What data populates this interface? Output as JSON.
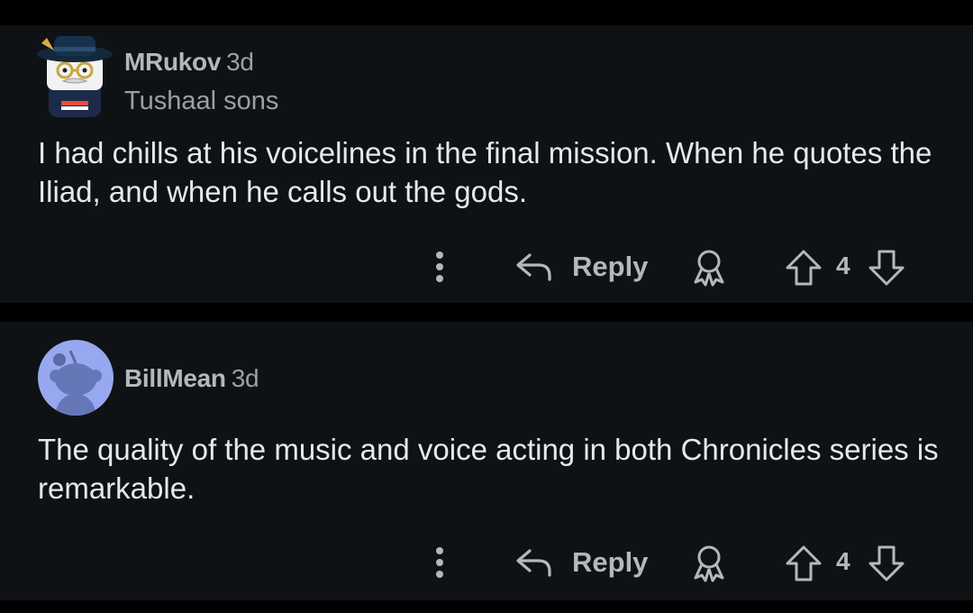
{
  "colors": {
    "background": "#000000",
    "card": "#0f1215",
    "icon": "#b4b8bc",
    "text": "#e6e8ea",
    "avatar_blue": "#97a8ee"
  },
  "comments": [
    {
      "username": "MRukov",
      "timestamp": "3d",
      "flair": "Tushaal sons",
      "avatar_icon": "custom-snoo-avatar-icon",
      "body": "I had chills at his voicelines in the final mission. When he quotes the Iliad, and when he calls out the gods.",
      "actions": {
        "more_icon": "more-vertical-icon",
        "reply_icon": "reply-arrow-icon",
        "reply_label": "Reply",
        "award_icon": "award-icon",
        "upvote_icon": "upvote-arrow-icon",
        "vote_count": "4",
        "downvote_icon": "downvote-arrow-icon"
      }
    },
    {
      "username": "BillMean",
      "timestamp": "3d",
      "avatar_icon": "default-snoo-avatar-icon",
      "body": "The quality of the music and voice acting in both Chronicles series is remarkable.",
      "actions": {
        "more_icon": "more-vertical-icon",
        "reply_icon": "reply-arrow-icon",
        "reply_label": "Reply",
        "award_icon": "award-icon",
        "upvote_icon": "upvote-arrow-icon",
        "vote_count": "4",
        "downvote_icon": "downvote-arrow-icon"
      }
    }
  ]
}
